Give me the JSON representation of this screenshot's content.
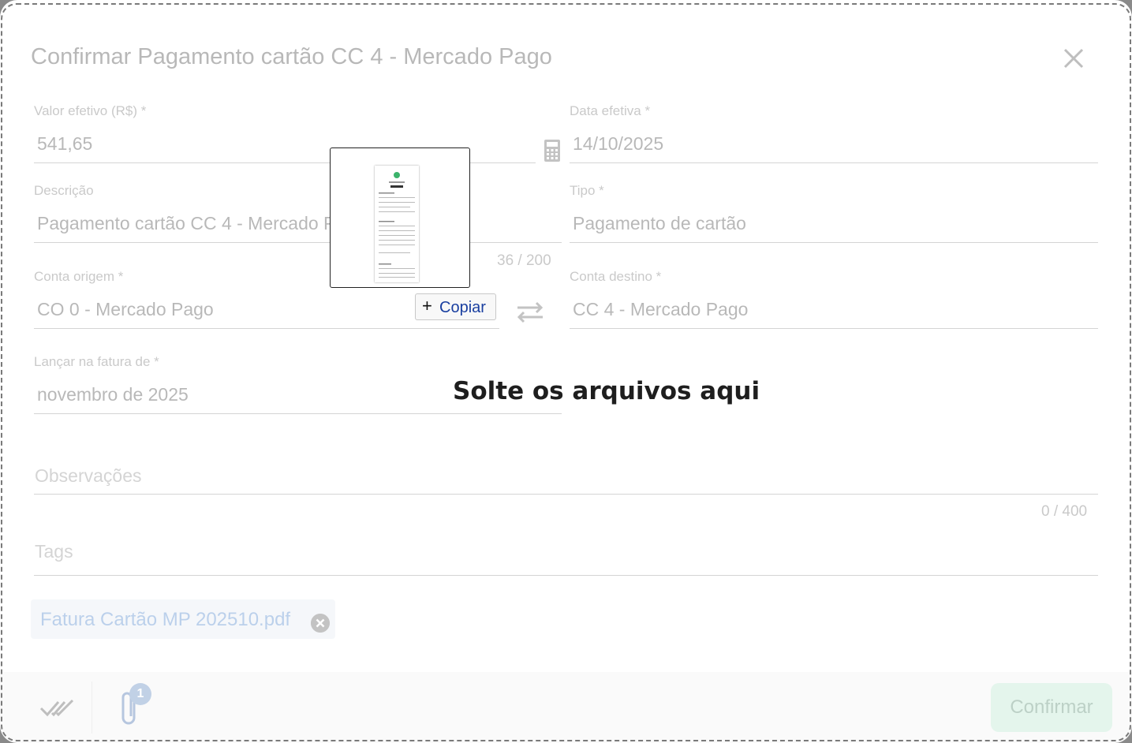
{
  "dialog": {
    "title": "Confirmar Pagamento cartão CC 4 - Mercado Pago"
  },
  "form": {
    "valor": {
      "label": "Valor efetivo (R$) *",
      "value": "541,65"
    },
    "data": {
      "label": "Data efetiva *",
      "value": "14/10/2025"
    },
    "descricao": {
      "label": "Descrição",
      "value": "Pagamento cartão CC 4 - Mercado Pago",
      "counter": "36 / 200"
    },
    "tipo": {
      "label": "Tipo *",
      "value": "Pagamento de cartão"
    },
    "conta_origem": {
      "label": "Conta origem *",
      "value": "CO 0 - Mercado Pago"
    },
    "conta_destino": {
      "label": "Conta destino *",
      "value": "CC 4 - Mercado Pago"
    },
    "fatura": {
      "label": "Lançar na fatura de *",
      "value": "novembro de 2025"
    },
    "observacoes": {
      "placeholder": "Observações",
      "counter": "0 / 400"
    },
    "tags": {
      "placeholder": "Tags"
    }
  },
  "attachments": [
    {
      "name": "Fatura Cartão MP 202510.pdf"
    }
  ],
  "footer": {
    "attachment_count": "1",
    "confirm_label": "Confirmar"
  },
  "drag_overlay": {
    "drop_text": "Solte os arquivos aqui",
    "copy_label": "Copiar"
  },
  "icons": [
    "close-icon",
    "calculator-icon",
    "swap-icon",
    "remove-chip-icon",
    "done-all-icon",
    "paperclip-icon",
    "plus-icon"
  ],
  "colors": {
    "confirm": "#a9e0c4",
    "chip_text": "#2a6bbf",
    "badge": "#3d6fb0"
  }
}
